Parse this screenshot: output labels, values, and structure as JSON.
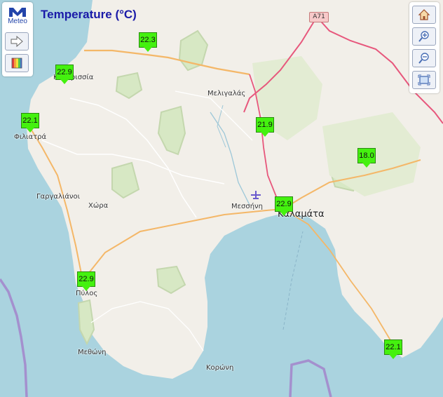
{
  "title": "Temperature (°C)",
  "logo": {
    "text": "Meteo",
    "color": "#2244aa"
  },
  "left_controls": [
    {
      "name": "next-arrow-button",
      "icon": "arrow-right-icon"
    },
    {
      "name": "color-scale-button",
      "icon": "color-palette-icon"
    }
  ],
  "right_controls": [
    {
      "name": "home-button",
      "icon": "home-icon"
    },
    {
      "name": "zoom-in-button",
      "icon": "zoom-in-icon"
    },
    {
      "name": "zoom-out-button",
      "icon": "zoom-out-icon"
    },
    {
      "name": "full-extent-button",
      "icon": "full-extent-icon"
    }
  ],
  "stations": [
    {
      "value": "22.3"
    },
    {
      "value": "22.9"
    },
    {
      "value": "22.1"
    },
    {
      "value": "21.9"
    },
    {
      "value": "18.0"
    },
    {
      "value": "22.9"
    },
    {
      "value": "22.9"
    },
    {
      "value": "22.1"
    }
  ],
  "places": [
    "Κυπαρισσία",
    "Μελιγαλάς",
    "Φιλιατρά",
    "Γαργαλιάνοι",
    "Χώρα",
    "Μεσσήνη",
    "Καλαμάτα",
    "Πύλος",
    "Μεθώνη",
    "Κορώνη"
  ],
  "road_shield": "A71",
  "colors": {
    "land": "#f2efe9",
    "sea": "#aad3df",
    "marker": "#44f10f",
    "title": "#1a1aa8",
    "border": "#a27fc9"
  }
}
